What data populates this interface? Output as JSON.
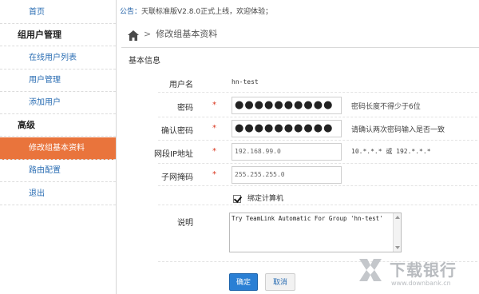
{
  "sidebar": {
    "items": [
      {
        "label": "首页",
        "type": "link"
      },
      {
        "label": "组用户管理",
        "type": "section"
      },
      {
        "label": "在线用户列表",
        "type": "link"
      },
      {
        "label": "用户管理",
        "type": "link"
      },
      {
        "label": "添加用户",
        "type": "link"
      },
      {
        "label": "高级",
        "type": "section"
      },
      {
        "label": "修改组基本资料",
        "type": "link",
        "active": true
      },
      {
        "label": "路由配置",
        "type": "link"
      },
      {
        "label": "退出",
        "type": "link"
      }
    ]
  },
  "notice": {
    "label": "公告：",
    "text": "天联标准版V2.8.0正式上线，欢迎体验；"
  },
  "breadcrumb": {
    "home_icon": "home-icon",
    "separator": ">",
    "current": "修改组基本资料"
  },
  "form": {
    "section_title": "基本信息",
    "username": {
      "label": "用户名",
      "value": "hn-test"
    },
    "password": {
      "label": "密码",
      "required": "*",
      "masked": "●●●●●●●●●●",
      "hint": "密码长度不得少于6位"
    },
    "confirm_password": {
      "label": "确认密码",
      "required": "*",
      "masked": "●●●●●●●●●●",
      "hint": "请确认两次密码输入是否一致"
    },
    "ip_segment": {
      "label": "网段IP地址",
      "required": "*",
      "value": "192.168.99.0",
      "hint": "10.*.*.* 或 192.*.*.*"
    },
    "subnet_mask": {
      "label": "子网掩码",
      "required": "*",
      "value": "255.255.255.0"
    },
    "bind_computer": {
      "label": "绑定计算机",
      "checked": true
    },
    "description": {
      "label": "说明",
      "value": "Try TeamLink Automatic For Group 'hn-test'"
    }
  },
  "buttons": {
    "confirm": "确定",
    "cancel": "取消"
  },
  "watermark": {
    "title": "下载银行",
    "url": "www.downbank.cn"
  },
  "colors": {
    "accent": "#e9743c",
    "link": "#2a6db3",
    "primary_button": "#2a7fd4",
    "required": "#d9341c"
  }
}
